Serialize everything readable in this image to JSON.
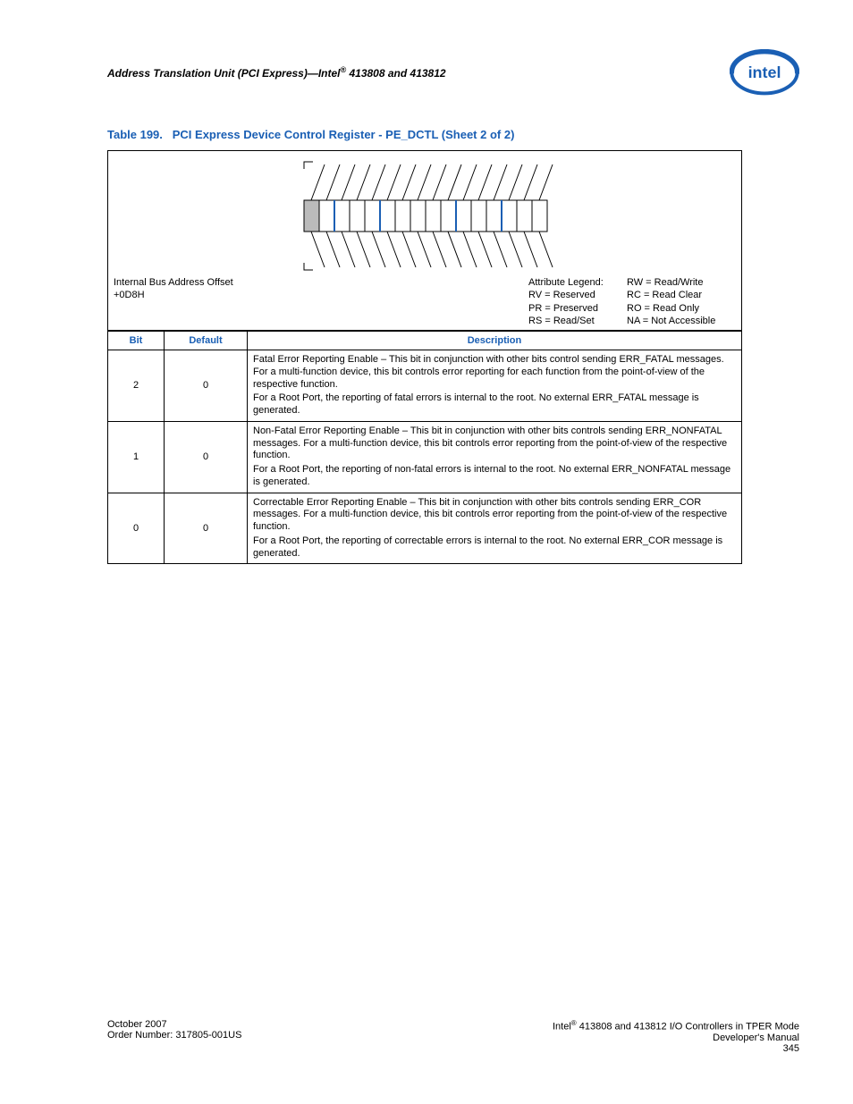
{
  "header": {
    "section_title_pre": "Address Translation Unit (PCI Express)—Intel",
    "section_title_post": " 413808 and 413812"
  },
  "caption": {
    "table_no": "Table 199.",
    "title": "PCI Express Device Control Register - PE_DCTL (Sheet 2 of 2)"
  },
  "diagram": {
    "offset_label": "Internal Bus Address Offset",
    "offset_value": "+0D8H",
    "legend_title": "Attribute Legend:",
    "legend_left": {
      "rv": "RV = Reserved",
      "pr": "PR = Preserved",
      "rs": "RS = Read/Set"
    },
    "legend_right": {
      "rw": "RW = Read/Write",
      "rc": "RC = Read Clear",
      "ro": "RO = Read Only",
      "na": "NA = Not Accessible"
    }
  },
  "table": {
    "headers": {
      "bit": "Bit",
      "def": "Default",
      "desc": "Description"
    },
    "rows": [
      {
        "bit": "2",
        "def": "0",
        "p1": "Fatal Error Reporting Enable – This bit in conjunction with other bits control sending ERR_FATAL messages. For a multi-function device, this bit controls error reporting for each function from the point-of-view of the respective function.",
        "p2": "For a Root Port, the reporting of fatal errors is internal to the root. No external ERR_FATAL message is generated."
      },
      {
        "bit": "1",
        "def": "0",
        "p1": "Non-Fatal Error Reporting Enable – This bit in conjunction with other bits controls sending ERR_NONFATAL messages. For a multi-function device, this bit controls error reporting from the point-of-view of the respective function.",
        "p2": "For a Root Port, the reporting of non-fatal errors is internal to the root. No external ERR_NONFATAL message is generated."
      },
      {
        "bit": "0",
        "def": "0",
        "p1": "Correctable Error Reporting Enable – This bit in conjunction with other bits controls sending ERR_COR messages. For a multi-function device, this bit controls error reporting from the point-of-view of the respective function.",
        "p2": "For a Root Port, the reporting of correctable errors is internal to the root. No external ERR_COR message is generated."
      }
    ]
  },
  "footer": {
    "date": "October 2007",
    "order": "Order Number: 317805-001US",
    "product_pre": "Intel",
    "product_post": " 413808 and 413812 I/O Controllers in TPER Mode",
    "manual": "Developer's Manual",
    "page": "345"
  }
}
